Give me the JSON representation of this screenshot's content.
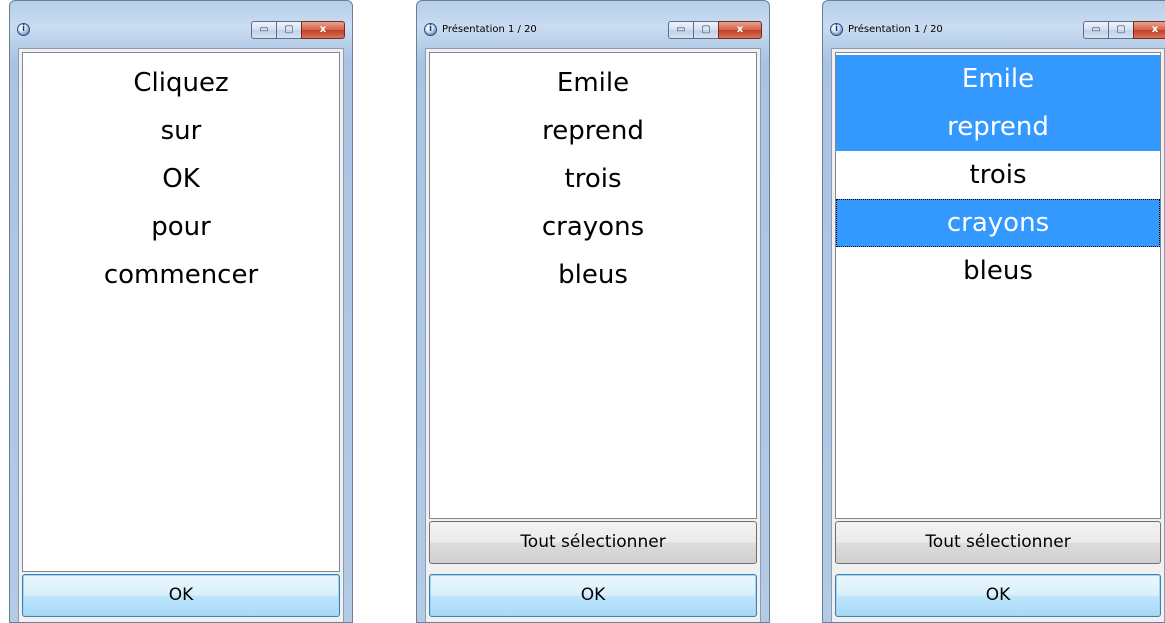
{
  "windows": [
    {
      "title": "",
      "items": [
        "Cliquez",
        "sur",
        "OK",
        "pour",
        "commencer"
      ],
      "ok_label": "OK"
    },
    {
      "title": "Présentation 1 / 20",
      "items": [
        "Emile",
        "reprend",
        "trois",
        "crayons",
        "bleus"
      ],
      "select_all_label": "Tout sélectionner",
      "ok_label": "OK"
    },
    {
      "title": "Présentation 1 / 20",
      "items": [
        "Emile",
        "reprend",
        "trois",
        "crayons",
        "bleus"
      ],
      "selected_items": [
        "Emile",
        "reprend",
        "crayons"
      ],
      "focused_item": "crayons",
      "select_all_label": "Tout sélectionner",
      "ok_label": "OK"
    }
  ],
  "caption_buttons": {
    "minimize": "▭",
    "maximize": "▢",
    "close": "x"
  },
  "icons": {
    "app": "info-balloon-icon"
  },
  "colors": {
    "selection": "#3399ff",
    "selection_text": "#ffffff"
  }
}
